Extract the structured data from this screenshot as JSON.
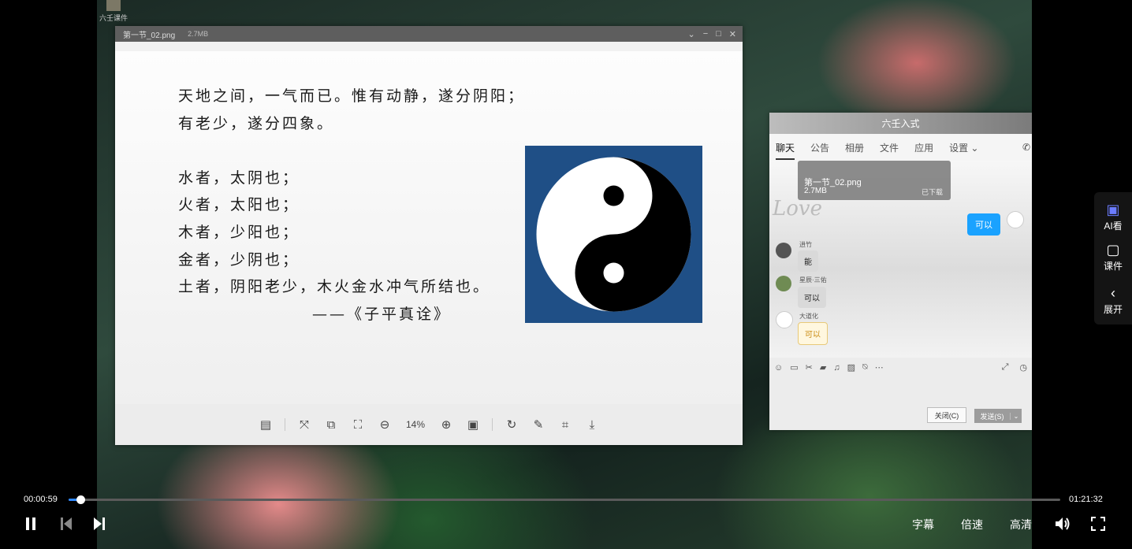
{
  "app": {
    "label": "六壬课件"
  },
  "viewer": {
    "filename": "第一节_02.png",
    "filesize": "2.7MB",
    "lines": [
      "天地之间，一气而已。惟有动静，遂分阴阳；",
      "有老少，遂分四象。",
      "",
      "水者，太阴也；",
      "火者，太阳也；",
      "木者，少阳也；",
      "金者，少阴也；",
      "土者，阴阳老少，木火金水冲气所结也。",
      "——《子平真诠》"
    ],
    "zoom": "14%"
  },
  "chat": {
    "title": "六壬入式",
    "tabs": [
      "聊天",
      "公告",
      "相册",
      "文件",
      "应用",
      "设置"
    ],
    "file_card": {
      "name": "第一节_02.png",
      "size": "2.7MB",
      "status": "已下载"
    },
    "watermark": "Love",
    "messages": [
      {
        "who": "me",
        "text": "可以"
      },
      {
        "name": "逍竹",
        "text": "能"
      },
      {
        "name": "星辰·三佑",
        "text": "可以"
      },
      {
        "name": "大道化",
        "text": "可以"
      }
    ],
    "close_label": "关闭(C)",
    "send_label": "发送(S)"
  },
  "side_panel": {
    "items": [
      "AI看",
      "课件",
      "展开"
    ]
  },
  "player": {
    "current_time": "00:00:59",
    "total_time": "01:21:32",
    "progress_fraction": 0.012,
    "subtitle_label": "字幕",
    "speed_label": "倍速",
    "quality_label": "高清"
  }
}
